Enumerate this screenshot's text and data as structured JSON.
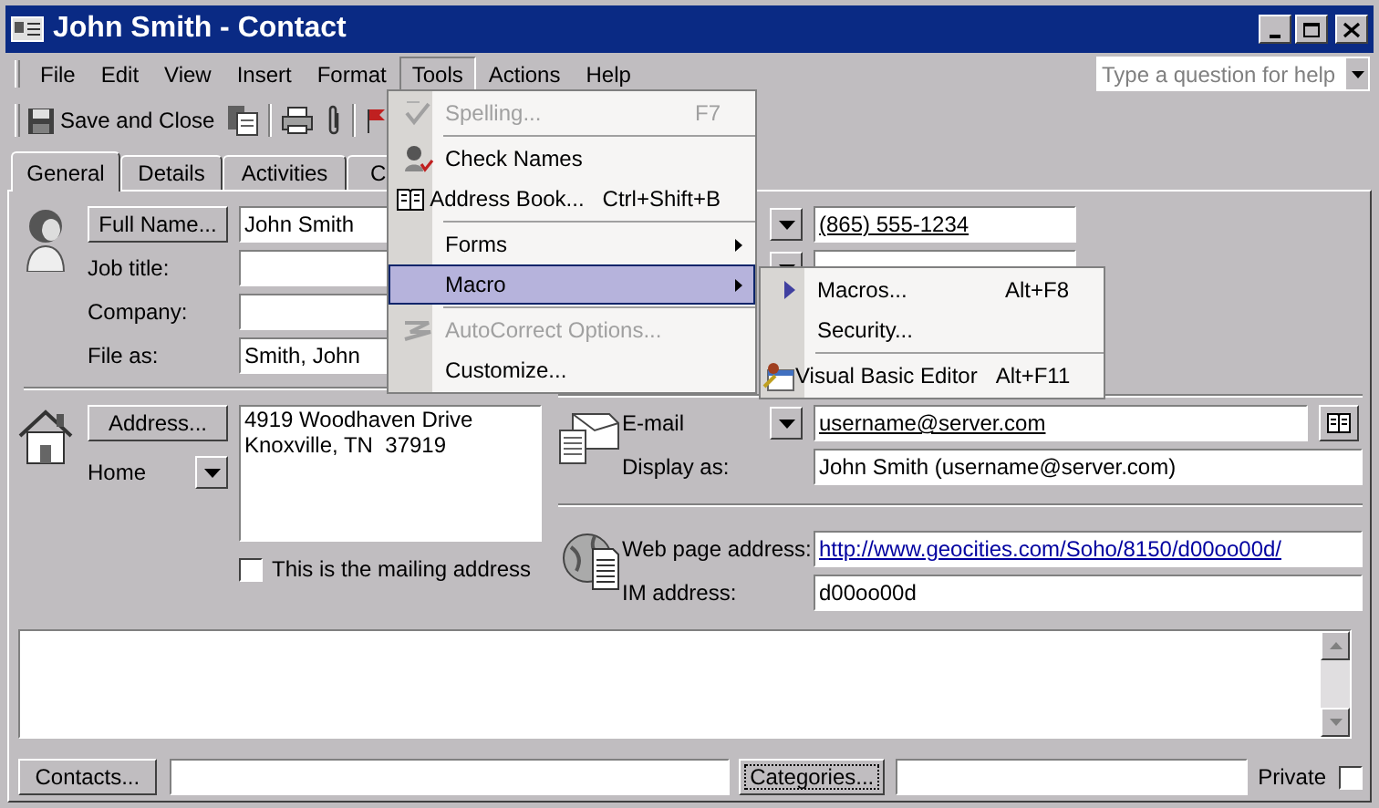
{
  "window": {
    "title": "John Smith - Contact"
  },
  "menu_bar": [
    {
      "label": "File",
      "selected": false
    },
    {
      "label": "Edit",
      "selected": false
    },
    {
      "label": "View",
      "selected": false
    },
    {
      "label": "Insert",
      "selected": false
    },
    {
      "label": "Format",
      "selected": false
    },
    {
      "label": "Tools",
      "selected": true
    },
    {
      "label": "Actions",
      "selected": false
    },
    {
      "label": "Help",
      "selected": false
    }
  ],
  "help_box": {
    "placeholder": "Type a question for help"
  },
  "toolbar": {
    "save_and_close": "Save and Close"
  },
  "tabs": [
    {
      "label": "General",
      "selected": true
    },
    {
      "label": "Details",
      "selected": false
    },
    {
      "label": "Activities",
      "selected": false
    },
    {
      "label": "C",
      "selected": false
    }
  ],
  "name": {
    "button": "Full Name...",
    "value": "John Smith",
    "fields": [
      {
        "label": "Job title:"
      },
      {
        "label": "Company:"
      },
      {
        "label": "File as:",
        "value": "Smith, John"
      }
    ]
  },
  "address": {
    "button": "Address...",
    "type": "Home",
    "value": "4919 Woodhaven Drive\nKnoxville, TN  37919",
    "mailing": {
      "label": "This is the mailing address",
      "checked": false
    }
  },
  "phones": [
    {
      "kind": "field",
      "value": "(865) 555-1234"
    },
    {
      "kind": "covered"
    }
  ],
  "email": {
    "label": "E-mail",
    "value": "username@server.com",
    "display_label": "Display as:",
    "display_value": "John Smith (username@server.com)"
  },
  "web": {
    "label": "Web page address:",
    "value": "http://www.geocities.com/Soho/8150/d00oo00d/"
  },
  "im": {
    "label": "IM address:",
    "value": "d00oo00d"
  },
  "footer": {
    "contacts_button": "Contacts...",
    "categories_button": "Categories...",
    "private": {
      "label": "Private",
      "checked": false
    }
  },
  "tools_menu": [
    {
      "kind": "item",
      "label": "Spelling...",
      "shortcut": "F7",
      "disabled": true,
      "selected": false
    },
    {
      "kind": "separator"
    },
    {
      "kind": "item",
      "label": "Check Names",
      "disabled": false,
      "selected": false
    },
    {
      "kind": "item",
      "label": "Address Book...",
      "shortcut": "Ctrl+Shift+B",
      "disabled": false,
      "selected": false
    },
    {
      "kind": "separator"
    },
    {
      "kind": "item",
      "label": "Forms",
      "submenu": true,
      "disabled": false,
      "selected": false
    },
    {
      "kind": "item",
      "label": "Macro",
      "submenu": true,
      "disabled": false,
      "selected": true
    },
    {
      "kind": "separator"
    },
    {
      "kind": "item",
      "label": "AutoCorrect Options...",
      "disabled": true,
      "selected": false
    },
    {
      "kind": "item",
      "label": "Customize...",
      "disabled": false,
      "selected": false
    }
  ],
  "macro_submenu": [
    {
      "kind": "item",
      "label": "Macros...",
      "shortcut": "Alt+F8",
      "selected": false
    },
    {
      "kind": "item",
      "label": "Security...",
      "selected": false
    },
    {
      "kind": "separator"
    },
    {
      "kind": "item",
      "label": "Visual Basic Editor",
      "shortcut": "Alt+F11",
      "selected": false
    }
  ]
}
